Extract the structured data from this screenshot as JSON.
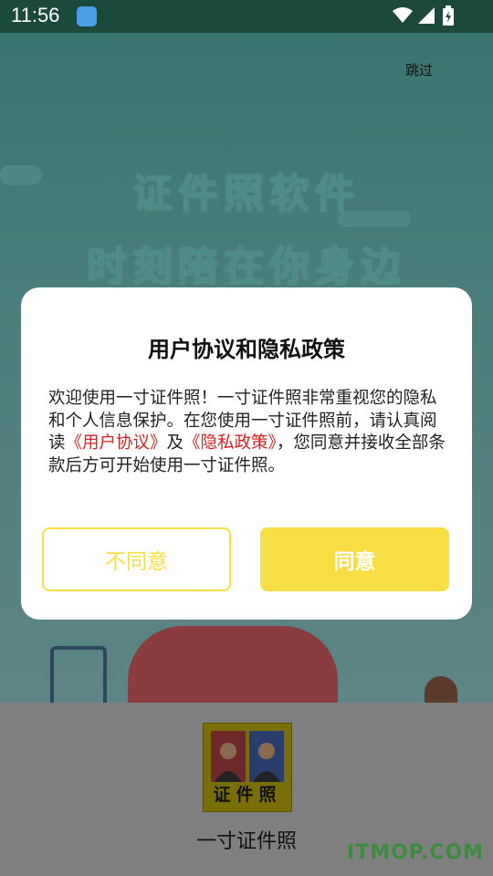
{
  "status_bar": {
    "time": "11:56"
  },
  "splash": {
    "skip_label": "跳过",
    "slogan_line1": "证件照软件",
    "slogan_line2": "时刻陪在你身边"
  },
  "dialog": {
    "title": "用户协议和隐私政策",
    "body_part1": "欢迎使用一寸证件照！一寸证件照非常重视您的隐私和个人信息保护。在您使用一寸证件照前，请认真阅读",
    "user_agreement_link": "《用户协议》",
    "body_part2": "及",
    "privacy_policy_link": "《隐私政策》",
    "body_part3": "，您同意并接收全部条款后方可开始使用一寸证件照。",
    "disagree_label": "不同意",
    "agree_label": "同意",
    "accent_color": "#f8de45",
    "link_color": "#e02020"
  },
  "bottom": {
    "logo_text": "证件照",
    "app_name": "一寸证件照",
    "watermark": "ITMOP.COM"
  }
}
